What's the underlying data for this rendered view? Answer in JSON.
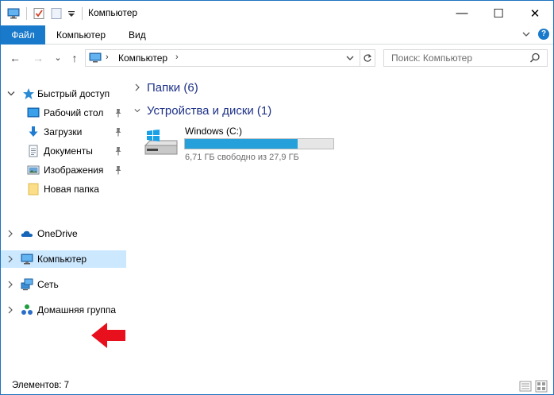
{
  "window": {
    "title": "Компьютер"
  },
  "controls": {
    "minimize": "—",
    "maximize": "☐",
    "close": "✕"
  },
  "ribbon": {
    "tabs": [
      {
        "label": "Файл",
        "active": true
      },
      {
        "label": "Компьютер"
      },
      {
        "label": "Вид"
      }
    ],
    "expand_icon": "chevron-down",
    "help_label": "?"
  },
  "navbar": {
    "back": "←",
    "forward": "→",
    "recent": "⌄",
    "up": "↑",
    "breadcrumb": "Компьютер",
    "breadcrumb_arrow": "›",
    "search_placeholder": "Поиск: Компьютер"
  },
  "sidebar": {
    "quick_access": {
      "label": "Быстрый доступ"
    },
    "quick_items": [
      {
        "label": "Рабочий стол",
        "icon": "desktop-icon",
        "pinned": true
      },
      {
        "label": "Загрузки",
        "icon": "download-icon",
        "pinned": true
      },
      {
        "label": "Документы",
        "icon": "document-icon",
        "pinned": true
      },
      {
        "label": "Изображения",
        "icon": "pictures-icon",
        "pinned": true
      },
      {
        "label": "Новая папка",
        "icon": "folder-icon",
        "pinned": false
      }
    ],
    "onedrive": {
      "label": "OneDrive"
    },
    "computer": {
      "label": "Компьютер",
      "selected": true
    },
    "network": {
      "label": "Сеть"
    },
    "homegroup": {
      "label": "Домашняя группа"
    }
  },
  "content": {
    "folders_group": {
      "label": "Папки (6)",
      "expanded": false
    },
    "devices_group": {
      "label": "Устройства и диски (1)",
      "expanded": true
    },
    "drives": [
      {
        "name": "Windows (C:)",
        "free_text": "6,71 ГБ свободно из 27,9 ГБ",
        "used_fraction": 0.76
      }
    ]
  },
  "statusbar": {
    "items_count": "Элементов: 7"
  },
  "colors": {
    "accent": "#1979ca",
    "selection": "#cce8ff",
    "drive_bar": "#26a0da",
    "annotation_arrow": "#e8101c"
  }
}
